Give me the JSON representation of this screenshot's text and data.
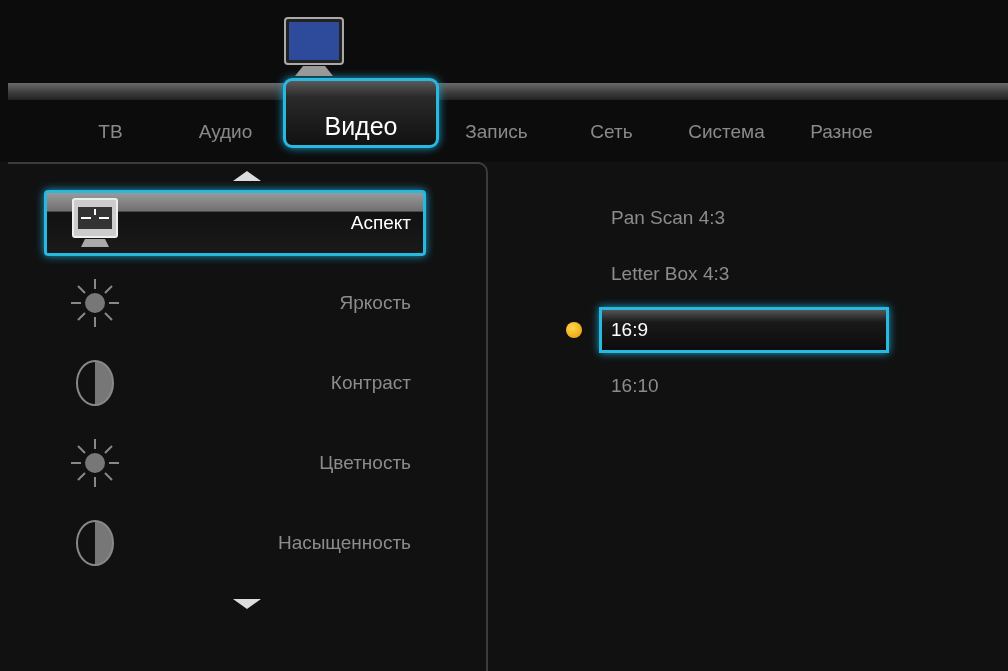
{
  "tabs": [
    {
      "label": "ТВ",
      "selected": false
    },
    {
      "label": "Аудио",
      "selected": false
    },
    {
      "label": "Видео",
      "selected": true
    },
    {
      "label": "Запись",
      "selected": false
    },
    {
      "label": "Сеть",
      "selected": false
    },
    {
      "label": "Система",
      "selected": false
    },
    {
      "label": "Разное",
      "selected": false
    }
  ],
  "settings": [
    {
      "label": "Аспект",
      "kind": "aspect",
      "selected": true
    },
    {
      "label": "Яркость",
      "kind": "brightness",
      "selected": false
    },
    {
      "label": "Контраст",
      "kind": "contrast",
      "selected": false
    },
    {
      "label": "Цветность",
      "kind": "brightness",
      "selected": false
    },
    {
      "label": "Насыщенность",
      "kind": "contrast",
      "selected": false
    }
  ],
  "options": [
    {
      "label": "Pan Scan 4:3",
      "selected": false,
      "current": false
    },
    {
      "label": "Letter Box 4:3",
      "selected": false,
      "current": false
    },
    {
      "label": "16:9",
      "selected": true,
      "current": true
    },
    {
      "label": "16:10",
      "selected": false,
      "current": false
    }
  ]
}
